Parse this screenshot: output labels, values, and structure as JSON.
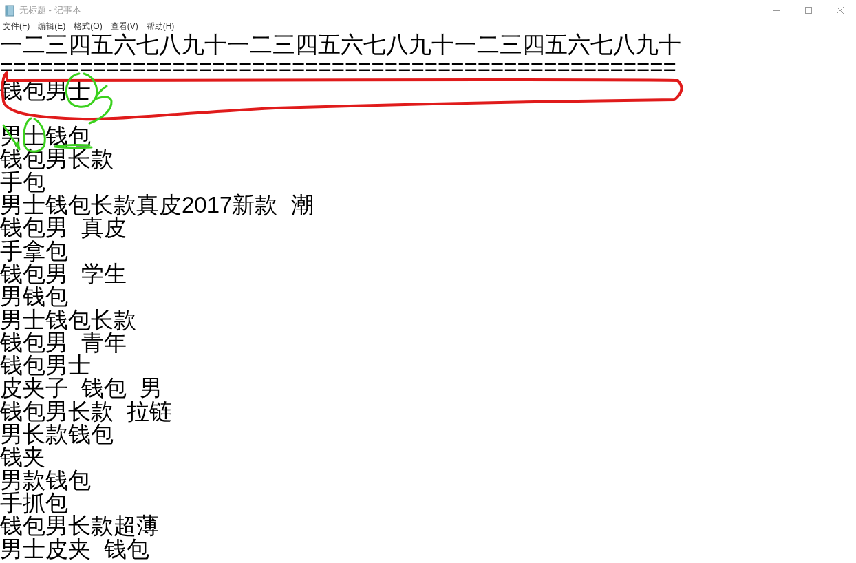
{
  "window": {
    "title": "无标题 - 记事本"
  },
  "menu": [
    "文件(F)",
    "编辑(E)",
    "格式(O)",
    "查看(V)",
    "帮助(H)"
  ],
  "editor": {
    "paragraphs": [
      [
        "一二三四五六七八九十一二三四五六七八九十一二三四五六七八九十",
        "===================================================",
        "钱包男士"
      ],
      [
        "男士钱包",
        "钱包男长款",
        "手包",
        "男士钱包长款真皮2017新款 潮",
        "钱包男 真皮",
        "手拿包",
        "钱包男 学生",
        "男钱包",
        "男士钱包长款",
        "钱包男 青年",
        "钱包男士",
        "皮夹子 钱包 男",
        "钱包男长款 拉链",
        "男长款钱包",
        "钱夹",
        "男款钱包",
        "手抓包",
        "钱包男长款超薄",
        "男士皮夹 钱包"
      ]
    ]
  }
}
